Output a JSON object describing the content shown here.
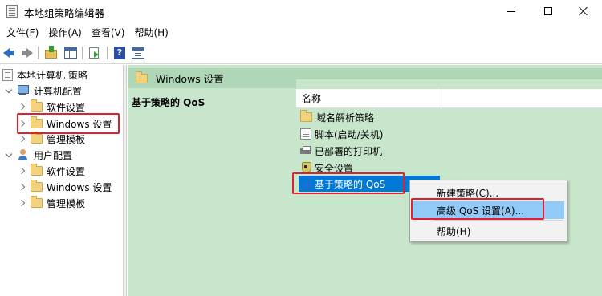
{
  "window": {
    "title": "本地组策略编辑器"
  },
  "menu": [
    "文件(F)",
    "操作(A)",
    "查看(V)",
    "帮助(H)"
  ],
  "toolbar": {
    "icons": [
      "back-arrow-icon",
      "forward-arrow-icon",
      "up-folder-icon",
      "show-hide-tree-icon",
      "export-list-icon",
      "help-icon",
      "properties-icon"
    ]
  },
  "tree": {
    "root": "本地计算机 策略",
    "computer_config": "计算机配置",
    "computer_children": [
      "软件设置",
      "Windows 设置",
      "管理模板"
    ],
    "user_config": "用户配置",
    "user_children": [
      "软件设置",
      "Windows 设置",
      "管理模板"
    ]
  },
  "right_pane": {
    "header": "Windows 设置",
    "description_title": "基于策略的 QoS",
    "column_name": "名称",
    "items": [
      "域名解析策略",
      "脚本(启动/关机)",
      "已部署的打印机",
      "安全设置",
      "基于策略的 QoS"
    ]
  },
  "context_menu": {
    "items": [
      "新建策略(C)...",
      "高级 QoS 设置(A)...",
      "帮助(H)"
    ],
    "highlighted": "高级 QoS 设置(A)..."
  },
  "colors": {
    "highlight_box": "#e0202e",
    "selection": "#0078d7",
    "menu_hover": "#91c9f7",
    "pane_background": "#c8e6cc"
  }
}
